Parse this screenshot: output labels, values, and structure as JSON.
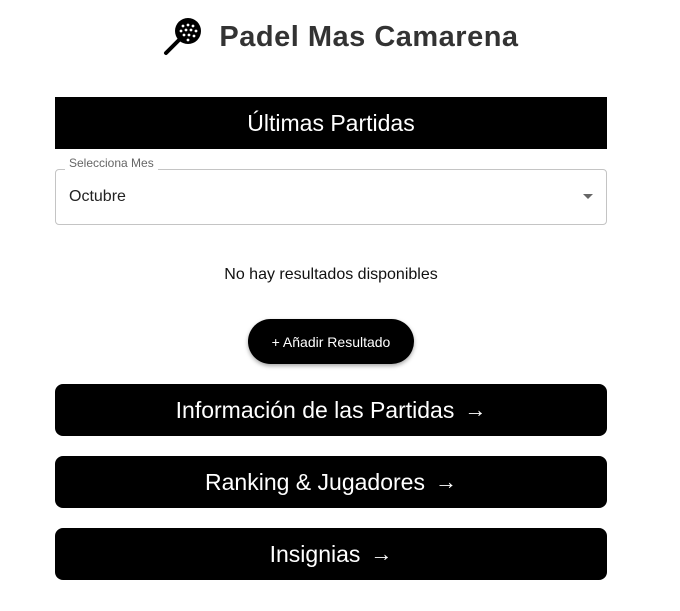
{
  "header": {
    "title": "Padel Mas Camarena",
    "logo_icon": "padel-racket-icon"
  },
  "section": {
    "title": "Últimas Partidas"
  },
  "month_select": {
    "label": "Selecciona Mes",
    "value": "Octubre"
  },
  "results": {
    "empty_message": "No hay resultados disponibles"
  },
  "actions": {
    "add_result_label": "+ Añadir Resultado"
  },
  "nav": [
    {
      "label": "Información de las Partidas",
      "arrow": "→"
    },
    {
      "label": "Ranking & Jugadores",
      "arrow": "→"
    },
    {
      "label": "Insignias",
      "arrow": "→"
    }
  ],
  "colors": {
    "primary": "#000000",
    "on_primary": "#ffffff",
    "title_text": "#333333",
    "border": "#c4c4c4"
  }
}
